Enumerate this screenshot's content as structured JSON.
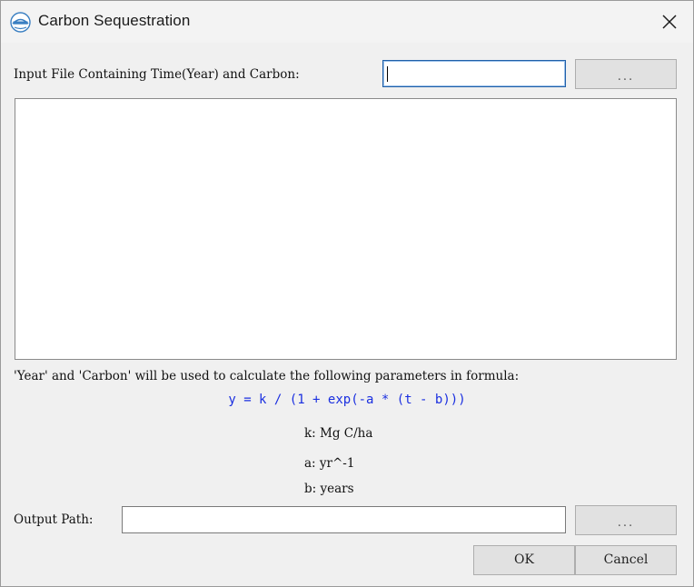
{
  "window": {
    "title": "Carbon Sequestration",
    "icon": "leaknn-logo-icon"
  },
  "input_file": {
    "label": "Input File Containing Time(Year) and Carbon:",
    "value": "",
    "browse_label": "..."
  },
  "preview_list": {
    "items": []
  },
  "description": "'Year' and 'Carbon' will be used to calculate the following parameters in formula:",
  "formula": "y = k / (1 + exp(-a * (t - b)))",
  "parameters": [
    {
      "name": "k:",
      "unit": "Mg C/ha"
    },
    {
      "name": "a:",
      "unit": "yr^-1"
    },
    {
      "name": "b:",
      "unit": "years"
    }
  ],
  "output_path": {
    "label": "Output Path:",
    "value": "",
    "browse_label": "..."
  },
  "buttons": {
    "ok": "OK",
    "cancel": "Cancel"
  },
  "colors": {
    "formula": "#1a2fe0",
    "focus_border": "#1f5fa8"
  }
}
